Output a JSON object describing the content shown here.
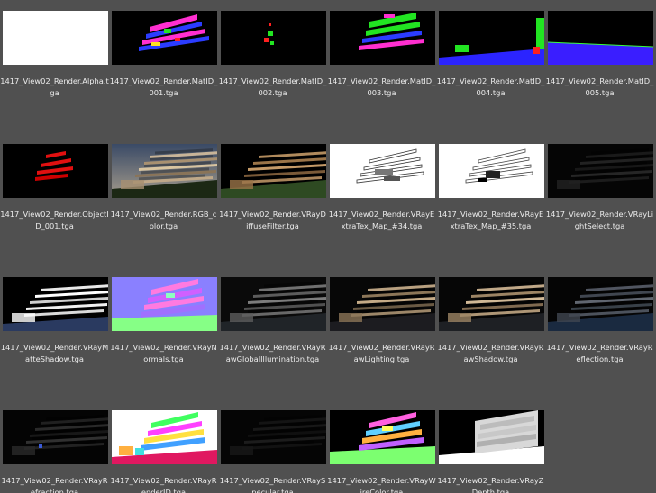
{
  "files": [
    {
      "name": "1417_View02_Render.Alpha.tga",
      "thumb": "alpha"
    },
    {
      "name": "1417_View02_Render.MatID_001.tga",
      "thumb": "matid-001"
    },
    {
      "name": "1417_View02_Render.MatID_002.tga",
      "thumb": "matid-002"
    },
    {
      "name": "1417_View02_Render.MatID_003.tga",
      "thumb": "matid-003"
    },
    {
      "name": "1417_View02_Render.MatID_004.tga",
      "thumb": "matid-004"
    },
    {
      "name": "1417_View02_Render.MatID_005.tga",
      "thumb": "matid-005"
    },
    {
      "name": "1417_View02_Render.ObjectID_001.tga",
      "thumb": "objectid-001"
    },
    {
      "name": "1417_View02_Render.RGB_color.tga",
      "thumb": "rgb-color"
    },
    {
      "name": "1417_View02_Render.VRayDiffuseFilter.tga",
      "thumb": "diffuse-filter"
    },
    {
      "name": "1417_View02_Render.VRayExtraTex_Map_#34.tga",
      "thumb": "extratex-34"
    },
    {
      "name": "1417_View02_Render.VRayExtraTex_Map_#35.tga",
      "thumb": "extratex-35"
    },
    {
      "name": "1417_View02_Render.VRayLightSelect.tga",
      "thumb": "light-select"
    },
    {
      "name": "1417_View02_Render.VRayMatteShadow.tga",
      "thumb": "matte-shadow"
    },
    {
      "name": "1417_View02_Render.VRayNormals.tga",
      "thumb": "normals"
    },
    {
      "name": "1417_View02_Render.VRayRawGlobalIllumination.tga",
      "thumb": "raw-gi"
    },
    {
      "name": "1417_View02_Render.VRayRawLighting.tga",
      "thumb": "raw-lighting"
    },
    {
      "name": "1417_View02_Render.VRayRawShadow.tga",
      "thumb": "raw-shadow"
    },
    {
      "name": "1417_View02_Render.VRayReflection.tga",
      "thumb": "reflection"
    },
    {
      "name": "1417_View02_Render.VRayRefraction.tga",
      "thumb": "refraction"
    },
    {
      "name": "1417_View02_Render.VRayRenderID.tga",
      "thumb": "render-id"
    },
    {
      "name": "1417_View02_Render.VRaySpecular.tga",
      "thumb": "specular"
    },
    {
      "name": "1417_View02_Render.VRayWireColor.tga",
      "thumb": "wire-color"
    },
    {
      "name": "1417_View02_Render.VRayZDepth.tga",
      "thumb": "zdepth"
    }
  ]
}
